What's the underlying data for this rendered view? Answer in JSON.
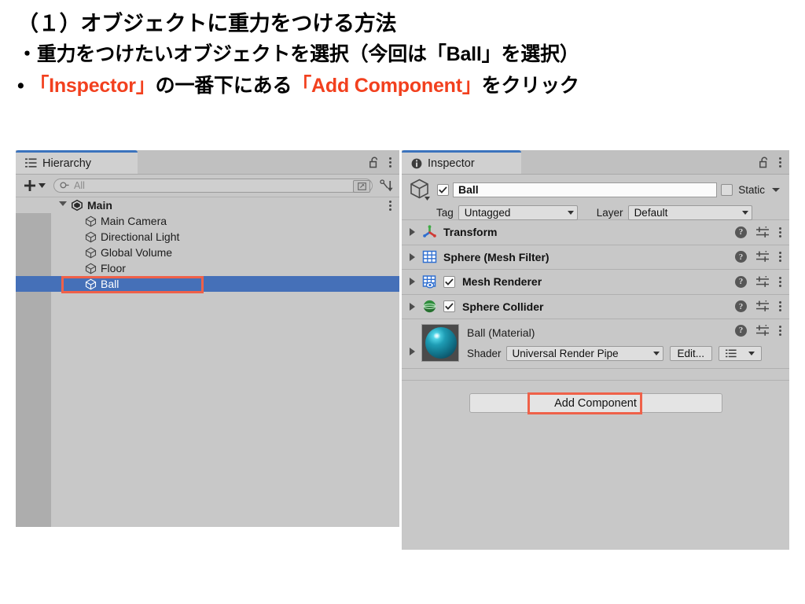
{
  "slide": {
    "heading": "（１）オブジェクトに重力をつける方法",
    "bullet1_marker": "・",
    "bullet1_text": "重力をつけたいオブジェクトを選択（今回は「Ball」を選択）",
    "bullet2_marker": "•",
    "bullet2_part1": "「Inspector」",
    "bullet2_part2": "の一番下にある",
    "bullet2_part3": "「Add Component」",
    "bullet2_part4": "をクリック",
    "accent_color": "#f2401e"
  },
  "hierarchy": {
    "tab_label": "Hierarchy",
    "tab_icon": "hierarchy-list-icon",
    "lock_icon": "lock-open-icon",
    "menu_icon": "kebab-menu-icon",
    "toolbar": {
      "add_label": "+",
      "add_caret": "▾",
      "search_placeholder": "All",
      "search_icon": "search-icon",
      "expand_icon": "open-in-new-icon",
      "sort_icon": "sort-icon"
    },
    "rows": [
      {
        "label": "Main",
        "depth": 0,
        "expanded": true,
        "selected": false,
        "bold": true,
        "icon": "unity-prefab-icon",
        "has_menu": true
      },
      {
        "label": "Main Camera",
        "depth": 1,
        "expanded": false,
        "selected": false,
        "bold": false,
        "icon": "gameobject-cube-icon",
        "has_menu": false
      },
      {
        "label": "Directional Light",
        "depth": 1,
        "expanded": false,
        "selected": false,
        "bold": false,
        "icon": "gameobject-cube-icon",
        "has_menu": false
      },
      {
        "label": "Global Volume",
        "depth": 1,
        "expanded": false,
        "selected": false,
        "bold": false,
        "icon": "gameobject-cube-icon",
        "has_menu": false
      },
      {
        "label": "Floor",
        "depth": 1,
        "expanded": false,
        "selected": false,
        "bold": false,
        "icon": "gameobject-cube-icon",
        "has_menu": false
      },
      {
        "label": "Ball",
        "depth": 1,
        "expanded": false,
        "selected": true,
        "bold": false,
        "icon": "gameobject-cube-icon",
        "has_menu": false
      }
    ],
    "selected_row_color": "#4570b8",
    "highlight_color": "#ef6149"
  },
  "inspector": {
    "tab_label": "Inspector",
    "tab_icon": "info-circle-icon",
    "lock_icon": "lock-open-icon",
    "menu_icon": "kebab-menu-icon",
    "object_icon": "gameobject-cube-icon",
    "enabled_checked": true,
    "object_name": "Ball",
    "static_checked": false,
    "static_label": "Static",
    "tag_label": "Tag",
    "tag_value": "Untagged",
    "layer_label": "Layer",
    "layer_value": "Default",
    "components": [
      {
        "name": "Transform",
        "icon": "transform-axis-icon",
        "has_checkbox": false,
        "checked": false
      },
      {
        "name": "Sphere (Mesh Filter)",
        "icon": "mesh-filter-grid-icon",
        "has_checkbox": false,
        "checked": false
      },
      {
        "name": "Mesh Renderer",
        "icon": "mesh-renderer-icon",
        "has_checkbox": true,
        "checked": true
      },
      {
        "name": "Sphere Collider",
        "icon": "sphere-collider-icon",
        "has_checkbox": true,
        "checked": true
      }
    ],
    "component_row_icons": {
      "help": "help-question-icon",
      "preset": "preset-sliders-icon",
      "menu": "kebab-menu-icon"
    },
    "material": {
      "title": "Ball (Material)",
      "preview_icon": "material-sphere-preview",
      "shader_label": "Shader",
      "shader_value": "Universal Render Pipe",
      "edit_label": "Edit...",
      "list_icon": "list-view-icon",
      "list_caret": "▾"
    },
    "add_component_label": "Add Component",
    "highlight_color": "#ef6149"
  }
}
